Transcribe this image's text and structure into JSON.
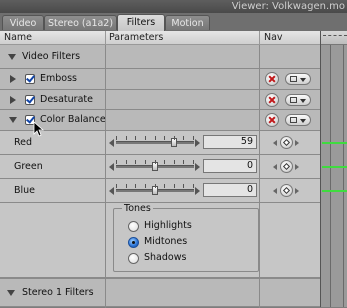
{
  "window_title": "Viewer: Volkwagen.mo",
  "tabs": [
    "Video",
    "Stereo (a1a2)",
    "Filters",
    "Motion"
  ],
  "active_tab": "Filters",
  "columns": {
    "name": "Name",
    "parameters": "Parameters",
    "nav": "Nav"
  },
  "video_filters_label": "Video Filters",
  "filters": [
    {
      "name": "Emboss",
      "enabled": true,
      "expanded": false
    },
    {
      "name": "Desaturate",
      "enabled": true,
      "expanded": false
    },
    {
      "name": "Color Balance",
      "enabled": true,
      "expanded": true
    }
  ],
  "params": [
    {
      "label": "Red",
      "value": "59",
      "slider_fraction": 0.76
    },
    {
      "label": "Green",
      "value": "0",
      "slider_fraction": 0.5
    },
    {
      "label": "Blue",
      "value": "0",
      "slider_fraction": 0.5
    }
  ],
  "tones": {
    "title": "Tones",
    "options": [
      "Highlights",
      "Midtones",
      "Shadows"
    ],
    "selected": "Midtones"
  },
  "stereo_filters_label": "Stereo 1 Filters",
  "colors": {
    "keyframe_line": "#3fdc3f",
    "radio_selected": "#2a73d6"
  }
}
